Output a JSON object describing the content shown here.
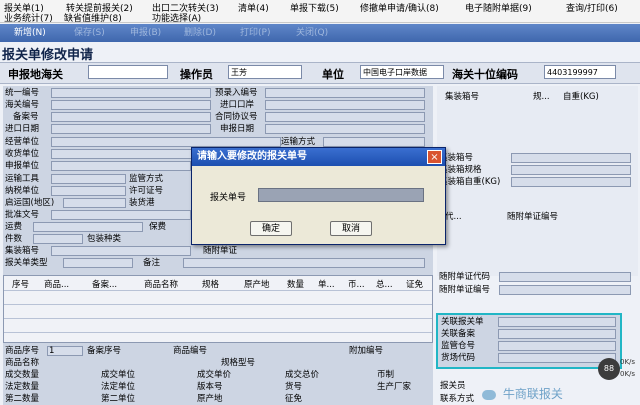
{
  "menu": [
    "报关单(1)",
    "转关提前报关(2)",
    "出口二次转关(3)",
    "清单(4)",
    "单报下载(5)",
    "修撤单申请/确认(8)",
    "电子随附单据(9)",
    "查询/打印(6)",
    "业务统计(7)",
    "缺省值维护(8)",
    "功能选择(A)"
  ],
  "toolbar": [
    "新增(N)",
    "保存(S)",
    "申报(B)",
    "删除(D)",
    "打印(P)",
    "关闭(Q)"
  ],
  "form_title": "报关单修改申请",
  "header": {
    "customs_label": "申报地海关",
    "operator_label": "操作员",
    "operator_value": "王芳",
    "unit_label": "单位",
    "unit_value": "中国电子口岸数据",
    "code_label": "海关十位编码",
    "code_value": "4403199997"
  },
  "left_labels": [
    "统一编号",
    "海关编号",
    "备案号",
    "进口日期",
    "经营单位",
    "收货单位",
    "申报单位",
    "运输工具",
    "纳税单位",
    "启运国(地区)",
    "批准文号",
    "运费",
    "件数",
    "集装箱号",
    "报关单类型"
  ],
  "mid_labels": [
    "预录入编号",
    "进口口岸",
    "合同协议号",
    "申报日期",
    "运输方式",
    "监管方式",
    "许可证号",
    "装货港",
    "保费",
    "包装种类",
    "随附单证",
    "备注"
  ],
  "right_labels": [
    "集装箱号",
    "规...",
    "自重(KG)",
    "集装箱号",
    "集装箱规格",
    "集装箱自重(KG)",
    "代...",
    "随附单证编号",
    "随附单证代码",
    "随附单证编号"
  ],
  "grid_headers": [
    "序号",
    "商品...",
    "备案...",
    "商品名称",
    "规格",
    "原产地",
    "数量",
    "单...",
    "币...",
    "总...",
    "证免"
  ],
  "bottom_rows": [
    [
      "商品序号",
      "1",
      "备案序号",
      "商品编号",
      "附加编号"
    ],
    [
      "商品名称",
      "规格型号"
    ],
    [
      "成交数量",
      "成交单位",
      "成交单价",
      "成交总价",
      "币制"
    ],
    [
      "法定数量",
      "法定单位",
      "版本号",
      "货号",
      "生产厂家"
    ],
    [
      "第二数量",
      "第二单位",
      "原产地",
      "征免"
    ]
  ],
  "cyan_box_labels": [
    "关联报关单",
    "关联备案",
    "监管仓号",
    "货场代码"
  ],
  "bottom_right_label": "报关员",
  "bottom_right_label2": "联系方式",
  "modal": {
    "title": "请输入要修改的报关单号",
    "field_label": "报关单号",
    "ok": "确定",
    "cancel": "取消",
    "close": "×"
  },
  "watermark": "牛商联报关",
  "speed": [
    "0K/s",
    "0K/s"
  ]
}
